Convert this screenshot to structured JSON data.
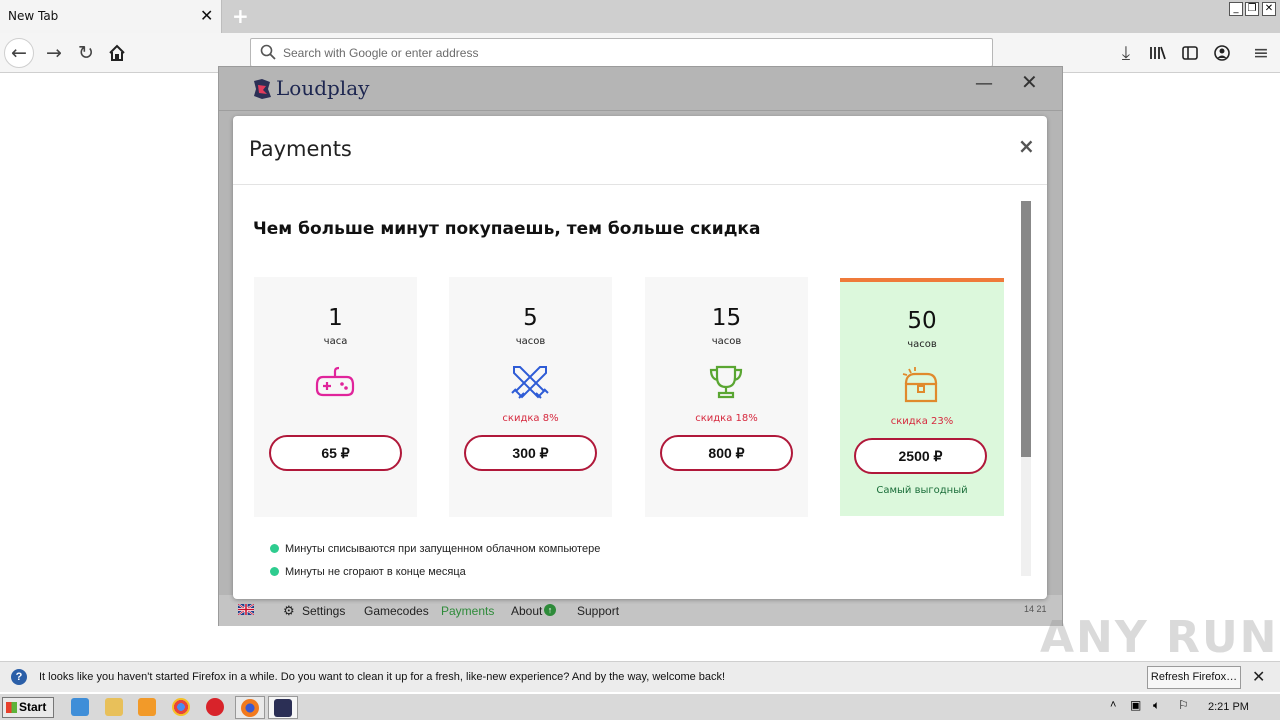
{
  "browser": {
    "tab_title": "New Tab",
    "url_placeholder": "Search with Google or enter address"
  },
  "app": {
    "name": "Loudplay",
    "footer": {
      "settings": "Settings",
      "gamecodes": "Gamecodes",
      "payments": "Payments",
      "about": "About",
      "support": "Support",
      "version": "14 21"
    }
  },
  "modal": {
    "title": "Payments",
    "close": "×",
    "headline": "Чем больше минут покупаешь, тем больше скидка",
    "plans": [
      {
        "hours": "1",
        "unit": "часа",
        "icon": "gamepad-icon",
        "discount": "",
        "price": "65 ₽"
      },
      {
        "hours": "5",
        "unit": "часов",
        "icon": "crossed-swords-icon",
        "discount": "скидка 8%",
        "price": "300 ₽"
      },
      {
        "hours": "15",
        "unit": "часов",
        "icon": "trophy-icon",
        "discount": "скидка 18%",
        "price": "800 ₽"
      },
      {
        "hours": "50",
        "unit": "часов",
        "icon": "treasure-chest-icon",
        "discount": "скидка 23%",
        "price": "2500 ₽",
        "label": "Самый выгодный"
      }
    ],
    "bullets": [
      "Минуты списываются при запущенном облачном компьютере",
      "Минуты не сгорают в конце месяца"
    ]
  },
  "notification": {
    "text": "It looks like you haven't started Firefox in a while. Do you want to clean it up for a fresh, like-new experience? And by the way, welcome back!",
    "button": "Refresh Firefox…"
  },
  "taskbar": {
    "start": "Start",
    "clock": "2:21 PM"
  },
  "watermark": "ANY RUN",
  "colors": {
    "accent_orange": "#ef7a3a",
    "price_border": "#b0183a",
    "discount_red": "#d6293e",
    "best_green_bg": "#dcf8dc",
    "payments_green": "#2e8b3a"
  }
}
